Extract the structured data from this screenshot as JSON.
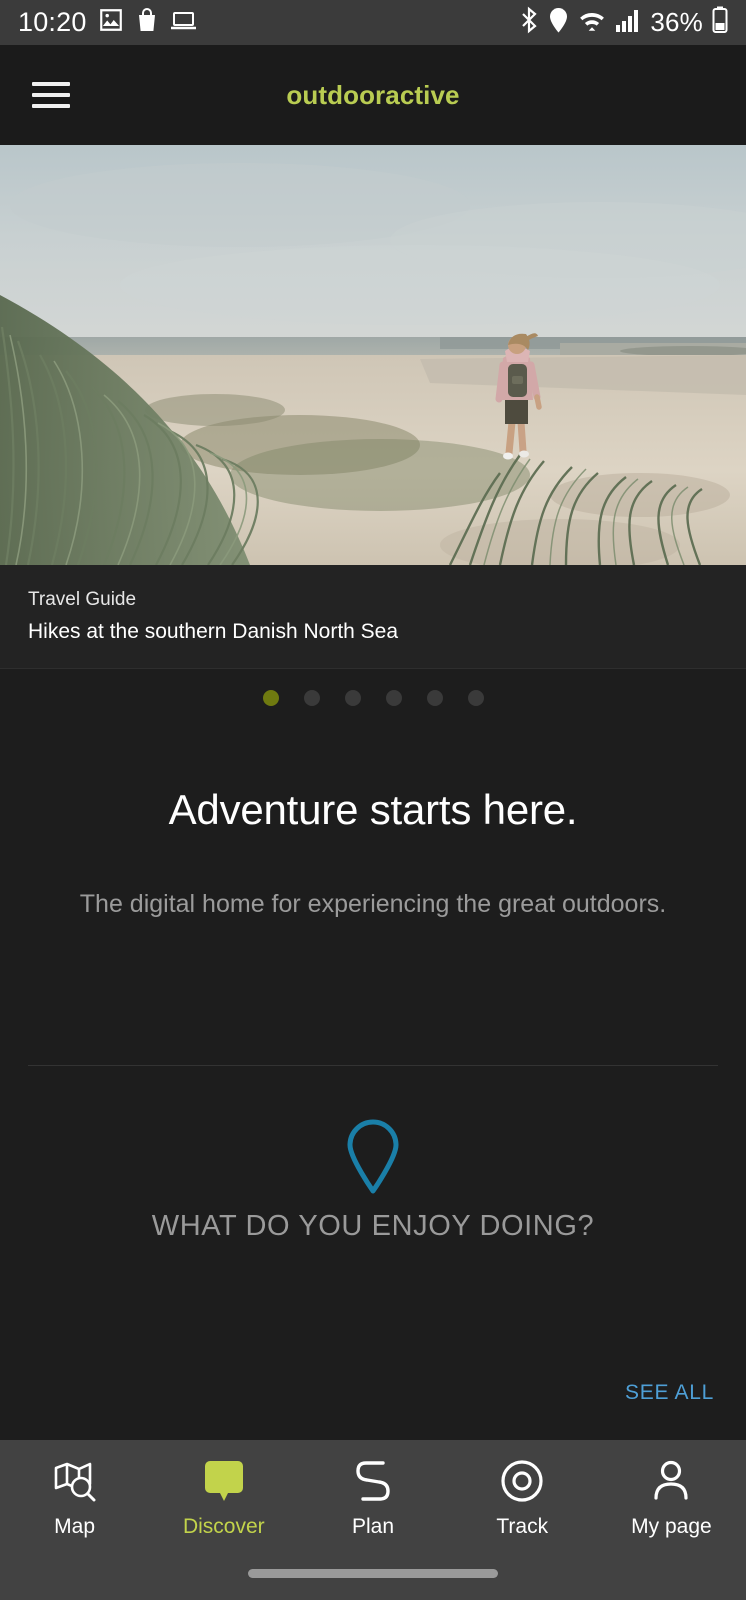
{
  "status_bar": {
    "time": "10:20",
    "battery": "36%",
    "left_icons": [
      "image-icon",
      "bag-icon",
      "laptop-icon"
    ],
    "right_icons": [
      "bluetooth-icon",
      "location-icon",
      "wifi-icon",
      "signal-icon",
      "battery-icon"
    ]
  },
  "header": {
    "menu_icon": "hamburger-menu-icon",
    "logo": "outdooractive",
    "logo_color": "#b9cc52"
  },
  "hero": {
    "alt": "Hiker with backpack walking on a sandy beach with dune grass under an overcast sky"
  },
  "caption": {
    "kicker": "Travel Guide",
    "title": "Hikes at the southern Danish North Sea"
  },
  "carousel": {
    "total_dots": 6,
    "active_index": 0,
    "active_color": "#6f7a10",
    "inactive_color": "#3a3a3a"
  },
  "intro": {
    "headline": "Adventure starts here.",
    "subhead": "The digital home for experiencing the great outdoors."
  },
  "enjoy_section": {
    "icon": "map-pin-icon",
    "icon_color": "#1a7fa8",
    "title": "WHAT DO YOU ENJOY DOING?",
    "see_all": "SEE ALL",
    "see_all_color": "#4e9fd6"
  },
  "bottom_nav": {
    "active_color": "#c2d34b",
    "items": [
      {
        "label": "Map",
        "icon": "map-search-icon",
        "active": false
      },
      {
        "label": "Discover",
        "icon": "discover-marker-icon",
        "active": true
      },
      {
        "label": "Plan",
        "icon": "route-path-icon",
        "active": false
      },
      {
        "label": "Track",
        "icon": "target-circle-icon",
        "active": false
      },
      {
        "label": "My page",
        "icon": "person-icon",
        "active": false
      }
    ]
  }
}
